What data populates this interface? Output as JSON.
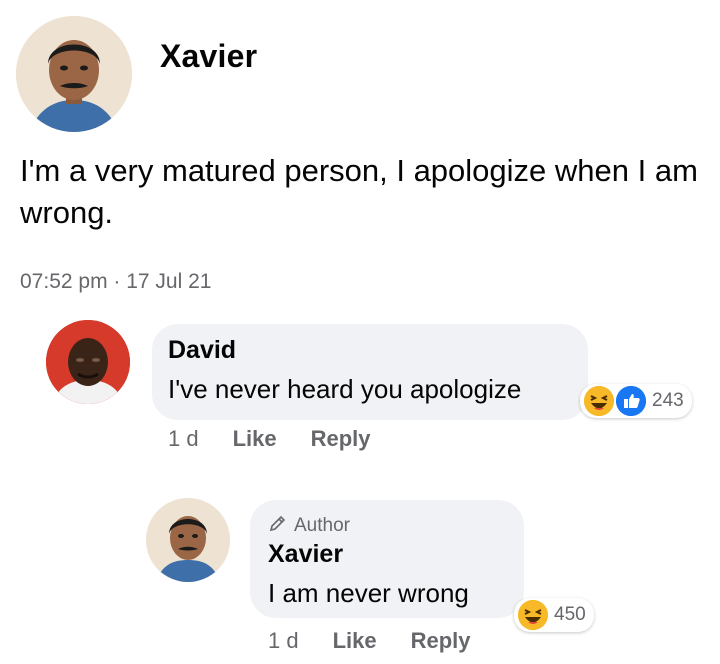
{
  "post": {
    "author": "Xavier",
    "text": "I'm a very matured person, I apologize when I am wrong.",
    "timestamp": "07:52 pm · 17 Jul 21"
  },
  "comments": [
    {
      "name": "David",
      "text": "I've never heard you apologize",
      "age": "1 d",
      "like": "Like",
      "reply": "Reply",
      "reaction_count": "243",
      "reaction_icons": [
        "haha-icon",
        "like-icon"
      ]
    },
    {
      "badge": "Author",
      "name": "Xavier",
      "text": "I am never wrong",
      "age": "1 d",
      "like": "Like",
      "reply": "Reply",
      "reaction_count": "450",
      "reaction_icons": [
        "haha-icon"
      ]
    }
  ],
  "colors": {
    "bubble": "#f0f2f5",
    "secondary_text": "#65676b",
    "like_blue": "#1877f2",
    "haha_yellow": "#f7b928"
  }
}
